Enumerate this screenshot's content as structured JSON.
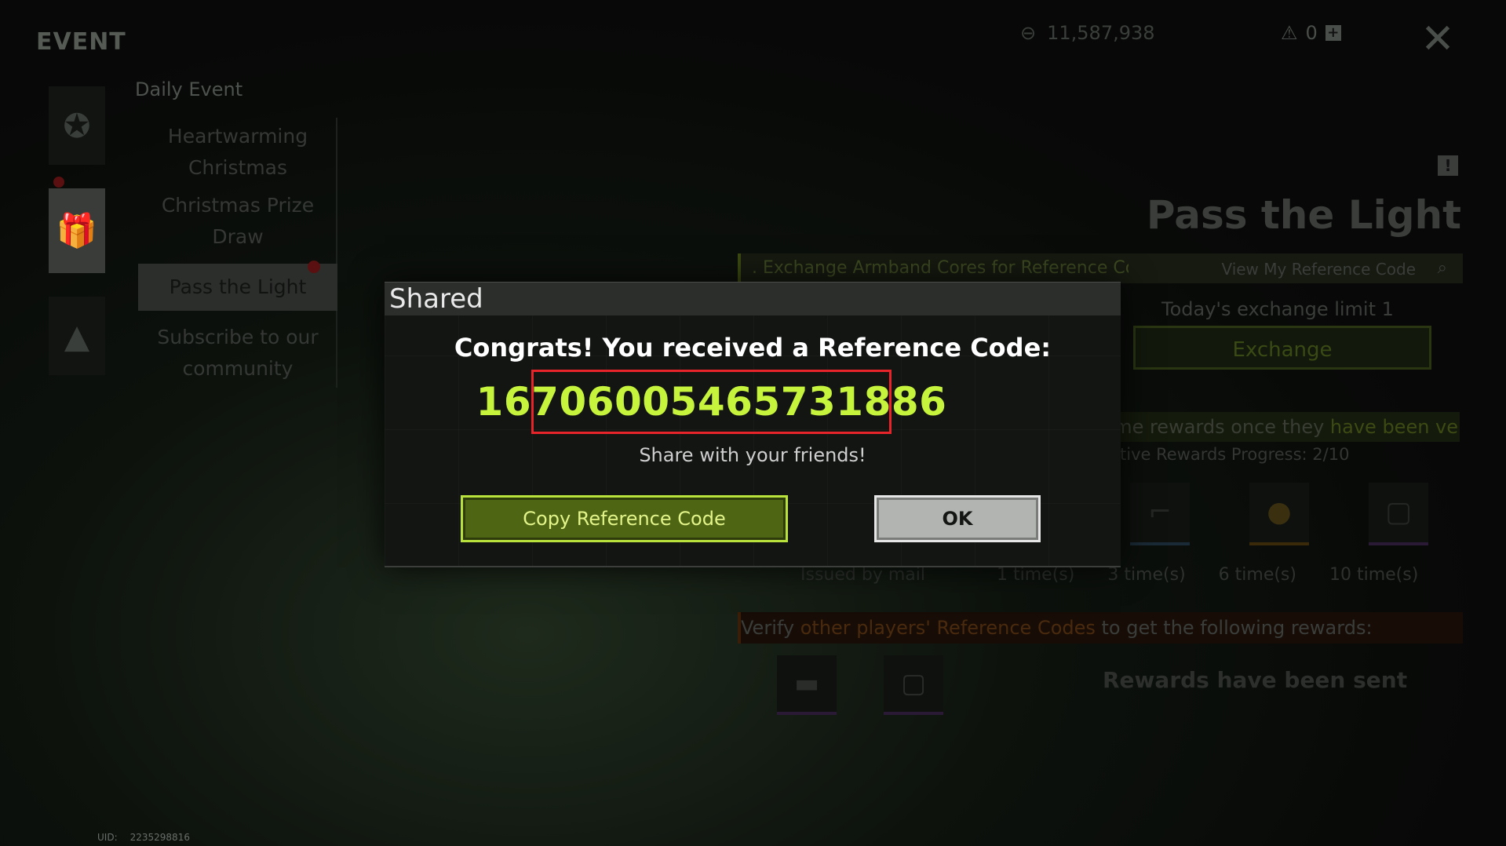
{
  "header": {
    "title": "EVENT",
    "currency_value": "11,587,938",
    "ticket_count": "0",
    "close_icon": "close-icon"
  },
  "sidebar": {
    "daily_label": "Daily Event",
    "events": [
      {
        "label": "Heartwarming Christmas"
      },
      {
        "label": "Christmas Prize Draw"
      },
      {
        "label": "Pass the Light"
      },
      {
        "label": "Subscribe to our community"
      }
    ],
    "selected_index": 2
  },
  "main": {
    "title": "Pass the Light",
    "exchange_text": ". Exchange Armband Cores for Reference Co",
    "view_code_label": "View My Reference Code",
    "exchange_limit_label": "Today's exchange limit",
    "exchange_limit_value": "1",
    "exchange_button": "Exchange",
    "rewards_text_a": "some rewards once they ",
    "rewards_text_b": "have been ve",
    "cumulative_progress": "ulative Rewards Progress: 2/10",
    "issued_by_mail": "Issued by mail",
    "times": [
      "1 time(s)",
      "3 time(s)",
      "6 time(s)",
      "10 time(s)"
    ],
    "verify_text_a": "Verify ",
    "verify_text_b": "other players' Reference Codes",
    "verify_text_c": " to get the following rewards:",
    "rewards_sent": "Rewards have been sent"
  },
  "footer": {
    "uid_label": "UID:",
    "uid_value": "2235298816"
  },
  "modal": {
    "title": "Shared",
    "congrats": "Congrats! You received a Reference Code:",
    "code": "1670600546573188",
    "code_suffix": "6",
    "share_text": "Share with your friends!",
    "copy_button": "Copy Reference Code",
    "ok_button": "OK"
  },
  "colors": {
    "code_green": "#c6f43c",
    "highlight_red": "#e8242b",
    "copy_button_bg": "#4e6514"
  }
}
